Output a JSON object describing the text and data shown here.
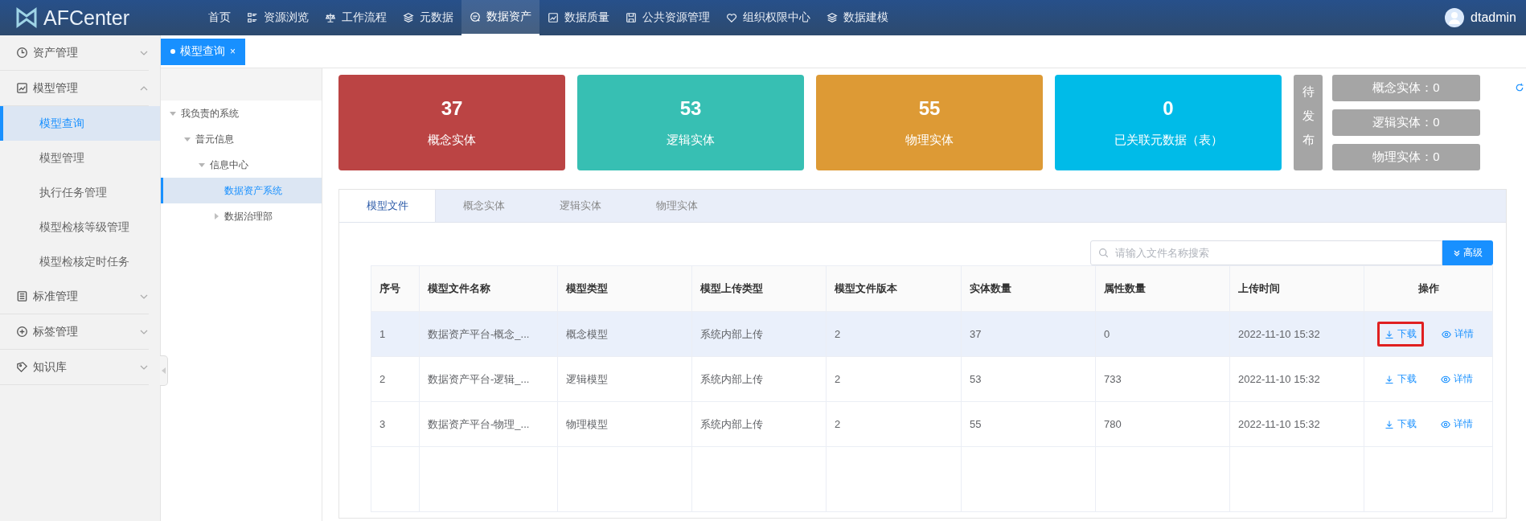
{
  "header": {
    "logo": "AFCenter",
    "user": "dtadmin",
    "nav": [
      {
        "label": "首页",
        "kind": "home",
        "selected": false
      },
      {
        "label": "资源浏览",
        "kind": "browse",
        "selected": false
      },
      {
        "label": "工作流程",
        "kind": "workflow",
        "selected": false
      },
      {
        "label": "元数据",
        "kind": "metadata",
        "selected": false
      },
      {
        "label": "数据资产",
        "kind": "assets",
        "selected": true
      },
      {
        "label": "数据质量",
        "kind": "quality",
        "selected": false
      },
      {
        "label": "公共资源管理",
        "kind": "resources",
        "selected": false
      },
      {
        "label": "组织权限中心",
        "kind": "permissions",
        "selected": false
      },
      {
        "label": "数据建模",
        "kind": "modeling",
        "selected": false
      }
    ]
  },
  "sidebar": {
    "groups": [
      {
        "label": "资产管理",
        "kind": "assets",
        "expanded": false
      },
      {
        "label": "模型管理",
        "kind": "models",
        "expanded": true,
        "items": [
          {
            "label": "模型查询",
            "selected": true
          },
          {
            "label": "模型管理",
            "selected": false
          },
          {
            "label": "执行任务管理",
            "selected": false
          },
          {
            "label": "模型检核等级管理",
            "selected": false
          },
          {
            "label": "模型检核定时任务",
            "selected": false
          }
        ]
      },
      {
        "label": "标准管理",
        "kind": "standards",
        "expanded": false
      },
      {
        "label": "标签管理",
        "kind": "labels",
        "expanded": false
      },
      {
        "label": "知识库",
        "kind": "knowledge",
        "expanded": false
      }
    ]
  },
  "page_tabs": [
    {
      "label": "模型查询",
      "selected": true,
      "close": "×"
    }
  ],
  "tree": [
    {
      "label": "我负责的系统",
      "expanded": true,
      "selected": false,
      "children": [
        {
          "label": "普元信息",
          "expanded": true,
          "selected": false,
          "children": [
            {
              "label": "信息中心",
              "expanded": true,
              "selected": false,
              "children": [
                {
                  "label": "数据资产系统",
                  "selected": true
                },
                {
                  "label": "数据治理部",
                  "expanded": false,
                  "selected": false
                }
              ]
            }
          ]
        }
      ]
    }
  ],
  "stats": [
    {
      "value": "37",
      "label": "概念实体",
      "color": "#bb4444"
    },
    {
      "value": "53",
      "label": "逻辑实体",
      "color": "#37bfb3"
    },
    {
      "value": "55",
      "label": "物理实体",
      "color": "#dd9a35"
    },
    {
      "value": "0",
      "label": "已关联元数据（表）",
      "color": "#00bbe8"
    }
  ],
  "pending": {
    "label": "待发布",
    "items": [
      "概念实体：0",
      "逻辑实体：0",
      "物理实体：0"
    ]
  },
  "tabs": [
    {
      "label": "模型文件",
      "selected": true
    },
    {
      "label": "概念实体",
      "selected": false
    },
    {
      "label": "逻辑实体",
      "selected": false
    },
    {
      "label": "物理实体",
      "selected": false
    }
  ],
  "search": {
    "placeholder": "请输入文件名称搜索",
    "button": "高级"
  },
  "table": {
    "columns": [
      "序号",
      "模型文件名称",
      "模型类型",
      "模型上传类型",
      "模型文件版本",
      "实体数量",
      "属性数量",
      "上传时间",
      "操作"
    ],
    "rows": [
      {
        "selected": true,
        "cells": [
          "1",
          "数据资产平台-概念_...",
          "概念模型",
          "系统内部上传",
          "2",
          "37",
          "0",
          "2022-11-10 15:32"
        ],
        "actions": [
          {
            "label": "下载",
            "kind": "download",
            "highlighted": true
          },
          {
            "label": "详情",
            "kind": "view",
            "highlighted": false
          }
        ]
      },
      {
        "selected": false,
        "cells": [
          "2",
          "数据资产平台-逻辑_...",
          "逻辑模型",
          "系统内部上传",
          "2",
          "53",
          "733",
          "2022-11-10 15:32"
        ],
        "actions": [
          {
            "label": "下载",
            "kind": "download",
            "highlighted": false
          },
          {
            "label": "详情",
            "kind": "view",
            "highlighted": false
          }
        ]
      },
      {
        "selected": false,
        "cells": [
          "3",
          "数据资产平台-物理_...",
          "物理模型",
          "系统内部上传",
          "2",
          "55",
          "780",
          "2022-11-10 15:32"
        ],
        "actions": [
          {
            "label": "下载",
            "kind": "download",
            "highlighted": false
          },
          {
            "label": "详情",
            "kind": "view",
            "highlighted": false
          }
        ]
      }
    ]
  }
}
